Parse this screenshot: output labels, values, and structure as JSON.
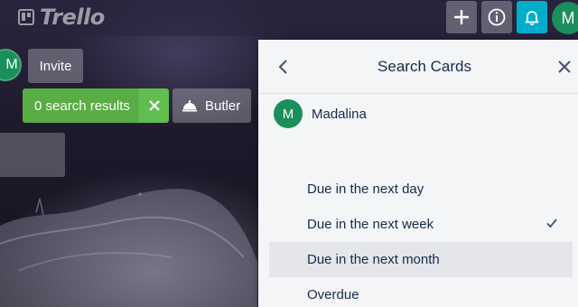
{
  "app": {
    "logo_text": "Trello"
  },
  "header": {
    "add_icon": "plus-icon",
    "info_icon": "info-icon",
    "notifications_icon": "bell-icon",
    "user_initial": "M",
    "bell_color": "#00aecc"
  },
  "board": {
    "member_initial": "M",
    "invite_label": "Invite",
    "search_results_label": "0 search results",
    "butler_label": "Butler"
  },
  "panel": {
    "title": "Search Cards",
    "member": {
      "initial": "M",
      "name": "Madalina"
    },
    "filters": [
      {
        "label": "Due in the next day",
        "checked": false
      },
      {
        "label": "Due in the next week",
        "checked": true
      },
      {
        "label": "Due in the next month",
        "checked": false
      },
      {
        "label": "Overdue",
        "checked": false
      }
    ]
  },
  "colors": {
    "accent_green": "#5aac44",
    "avatar_green": "#1a8f5b"
  }
}
